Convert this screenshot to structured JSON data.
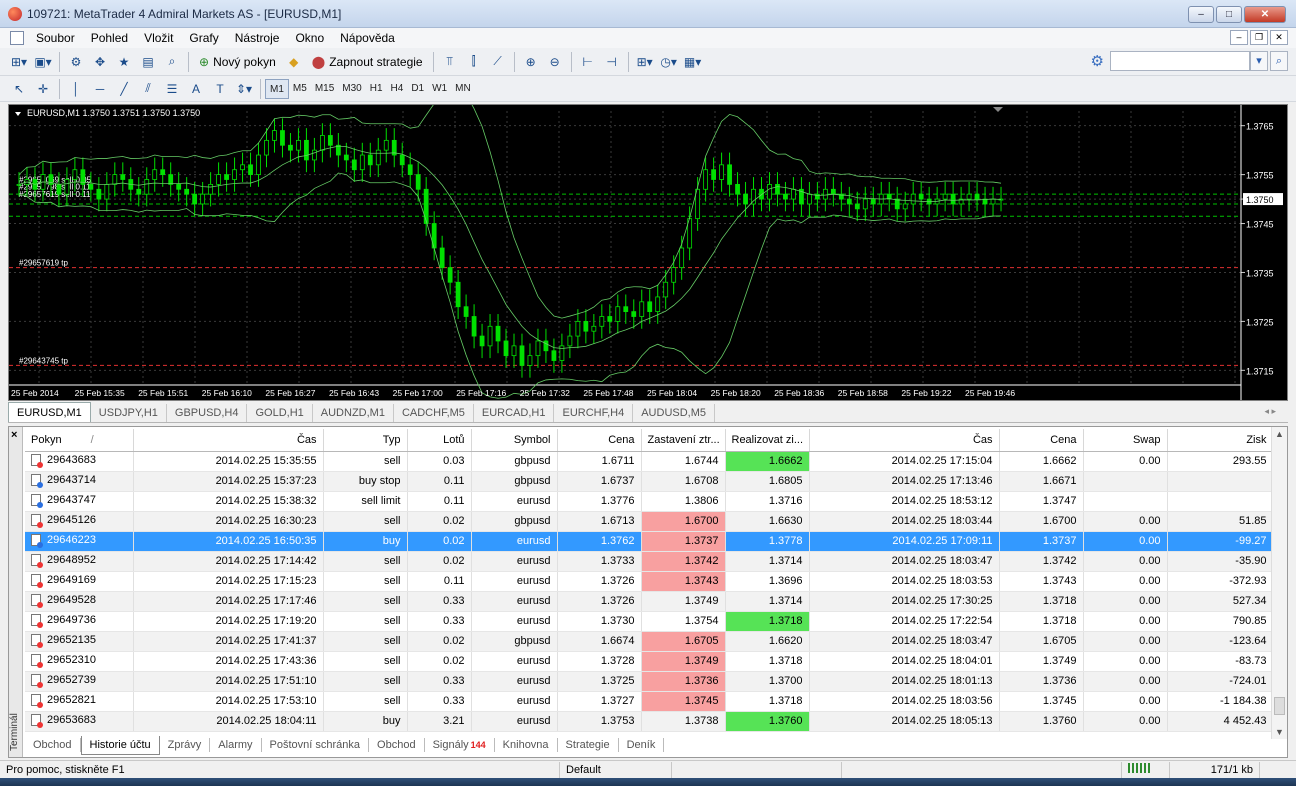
{
  "window": {
    "title": "109721: MetaTrader 4 Admiral Markets AS - [EURUSD,M1]",
    "buttons": [
      "–",
      "□",
      "✕"
    ]
  },
  "menu": [
    "Soubor",
    "Pohled",
    "Vložit",
    "Grafy",
    "Nástroje",
    "Okno",
    "Nápověda"
  ],
  "toolbar": {
    "new_order": "Nový pokyn",
    "auto_trading": "Zapnout strategie"
  },
  "timeframes": [
    "M1",
    "M5",
    "M15",
    "M30",
    "H1",
    "H4",
    "D1",
    "W1",
    "MN"
  ],
  "active_timeframe": "M1",
  "chart": {
    "header": "EURUSD,M1  1.3750 1.3751 1.3750 1.3750",
    "current_price": "1.3750",
    "price_labels": [
      "1.3765",
      "1.3755",
      "1.3750",
      "1.3745",
      "1.3735",
      "1.3725",
      "1.3715"
    ],
    "time_labels": [
      "25 Feb 2014",
      "25 Feb 15:35",
      "25 Feb 15:51",
      "25 Feb 16:10",
      "25 Feb 16:27",
      "25 Feb 16:43",
      "25 Feb 17:00",
      "25 Feb 17:16",
      "25 Feb 17:32",
      "25 Feb 17:48",
      "25 Feb 18:04",
      "25 Feb 18:20",
      "25 Feb 18:36",
      "25 Feb 18:58",
      "25 Feb 19:22",
      "25 Feb 19:46"
    ],
    "order_labels": [
      "#29654069 sell 0.05",
      "#29657798 sell 0.11",
      "#29657619 sell 0.11",
      "#29657619 tp",
      "#29643745 tp"
    ],
    "candles_close": [
      1.3753,
      1.3754,
      1.3752,
      1.3755,
      1.3753,
      1.3751,
      1.3754,
      1.3756,
      1.3753,
      1.3752,
      1.375,
      1.3753,
      1.3755,
      1.3754,
      1.3752,
      1.3751,
      1.3754,
      1.3756,
      1.3755,
      1.3753,
      1.3752,
      1.3751,
      1.3749,
      1.3751,
      1.3753,
      1.3755,
      1.3754,
      1.3756,
      1.3757,
      1.3755,
      1.3759,
      1.3762,
      1.3764,
      1.3761,
      1.376,
      1.3762,
      1.3758,
      1.376,
      1.3763,
      1.3761,
      1.3759,
      1.3758,
      1.3756,
      1.3759,
      1.3757,
      1.376,
      1.3762,
      1.3759,
      1.3757,
      1.3755,
      1.3752,
      1.3745,
      1.374,
      1.3736,
      1.3733,
      1.3728,
      1.3726,
      1.3722,
      1.372,
      1.3724,
      1.3721,
      1.3718,
      1.372,
      1.3716,
      1.3718,
      1.3721,
      1.3719,
      1.3717,
      1.372,
      1.3722,
      1.3725,
      1.3723,
      1.3724,
      1.3726,
      1.3725,
      1.3728,
      1.3727,
      1.3726,
      1.3729,
      1.3727,
      1.373,
      1.3733,
      1.3736,
      1.374,
      1.3746,
      1.3752,
      1.3756,
      1.3754,
      1.3757,
      1.3753,
      1.3751,
      1.3749,
      1.3752,
      1.375,
      1.3753,
      1.3751,
      1.375,
      1.3752,
      1.3749,
      1.3751,
      1.375,
      1.3752,
      1.3751,
      1.375,
      1.3749,
      1.3748,
      1.375,
      1.3749,
      1.3751,
      1.375,
      1.3748,
      1.3749,
      1.3751,
      1.375,
      1.3749,
      1.375,
      1.3751,
      1.3749,
      1.375,
      1.3751,
      1.375,
      1.3749,
      1.375,
      1.375
    ]
  },
  "chart_tabs": [
    "EURUSD,M1",
    "USDJPY,H1",
    "GBPUSD,H4",
    "GOLD,H1",
    "AUDNZD,M1",
    "CADCHF,M5",
    "EURCAD,H1",
    "EURCHF,H4",
    "AUDUSD,M5"
  ],
  "active_chart_tab": "EURUSD,M1",
  "history": {
    "columns": [
      "Pokyn",
      "Čas",
      "Typ",
      "Lotů",
      "Symbol",
      "Cena",
      "Zastavení ztr...",
      "Realizovat zi...",
      "Čas",
      "Cena",
      "Swap",
      "Zisk"
    ],
    "sort_indicator": "/",
    "rows": [
      {
        "id": "29643683",
        "open": "2014.02.25 15:35:55",
        "type": "sell",
        "lots": "0.03",
        "symbol": "gbpusd",
        "price": "1.6711",
        "sl": "1.6744",
        "tp": "1.6662",
        "close": "2014.02.25 17:15:04",
        "cprice": "1.6662",
        "swap": "0.00",
        "profit": "293.55",
        "sl_hl": "",
        "tp_hl": "green",
        "side": "sell"
      },
      {
        "id": "29643714",
        "open": "2014.02.25 15:37:23",
        "type": "buy stop",
        "lots": "0.11",
        "symbol": "gbpusd",
        "price": "1.6737",
        "sl": "1.6708",
        "tp": "1.6805",
        "close": "2014.02.25 17:13:46",
        "cprice": "1.6671",
        "swap": "",
        "profit": "",
        "sl_hl": "",
        "tp_hl": "",
        "side": "buy"
      },
      {
        "id": "29643747",
        "open": "2014.02.25 15:38:32",
        "type": "sell limit",
        "lots": "0.11",
        "symbol": "eurusd",
        "price": "1.3776",
        "sl": "1.3806",
        "tp": "1.3716",
        "close": "2014.02.25 18:53:12",
        "cprice": "1.3747",
        "swap": "",
        "profit": "",
        "sl_hl": "",
        "tp_hl": "",
        "side": "buy"
      },
      {
        "id": "29645126",
        "open": "2014.02.25 16:30:23",
        "type": "sell",
        "lots": "0.02",
        "symbol": "gbpusd",
        "price": "1.6713",
        "sl": "1.6700",
        "tp": "1.6630",
        "close": "2014.02.25 18:03:44",
        "cprice": "1.6700",
        "swap": "0.00",
        "profit": "51.85",
        "sl_hl": "red",
        "tp_hl": "",
        "side": "sell"
      },
      {
        "id": "29646223",
        "open": "2014.02.25 16:50:35",
        "type": "buy",
        "lots": "0.02",
        "symbol": "eurusd",
        "price": "1.3762",
        "sl": "1.3737",
        "tp": "1.3778",
        "close": "2014.02.25 17:09:11",
        "cprice": "1.3737",
        "swap": "0.00",
        "profit": "-99.27",
        "sl_hl": "red",
        "tp_hl": "",
        "side": "buy",
        "selected": true
      },
      {
        "id": "29648952",
        "open": "2014.02.25 17:14:42",
        "type": "sell",
        "lots": "0.02",
        "symbol": "eurusd",
        "price": "1.3733",
        "sl": "1.3742",
        "tp": "1.3714",
        "close": "2014.02.25 18:03:47",
        "cprice": "1.3742",
        "swap": "0.00",
        "profit": "-35.90",
        "sl_hl": "red",
        "tp_hl": "",
        "side": "sell"
      },
      {
        "id": "29649169",
        "open": "2014.02.25 17:15:23",
        "type": "sell",
        "lots": "0.11",
        "symbol": "eurusd",
        "price": "1.3726",
        "sl": "1.3743",
        "tp": "1.3696",
        "close": "2014.02.25 18:03:53",
        "cprice": "1.3743",
        "swap": "0.00",
        "profit": "-372.93",
        "sl_hl": "red",
        "tp_hl": "",
        "side": "sell"
      },
      {
        "id": "29649528",
        "open": "2014.02.25 17:17:46",
        "type": "sell",
        "lots": "0.33",
        "symbol": "eurusd",
        "price": "1.3726",
        "sl": "1.3749",
        "tp": "1.3714",
        "close": "2014.02.25 17:30:25",
        "cprice": "1.3718",
        "swap": "0.00",
        "profit": "527.34",
        "sl_hl": "",
        "tp_hl": "",
        "side": "sell"
      },
      {
        "id": "29649736",
        "open": "2014.02.25 17:19:20",
        "type": "sell",
        "lots": "0.33",
        "symbol": "eurusd",
        "price": "1.3730",
        "sl": "1.3754",
        "tp": "1.3718",
        "close": "2014.02.25 17:22:54",
        "cprice": "1.3718",
        "swap": "0.00",
        "profit": "790.85",
        "sl_hl": "",
        "tp_hl": "green",
        "side": "sell"
      },
      {
        "id": "29652135",
        "open": "2014.02.25 17:41:37",
        "type": "sell",
        "lots": "0.02",
        "symbol": "gbpusd",
        "price": "1.6674",
        "sl": "1.6705",
        "tp": "1.6620",
        "close": "2014.02.25 18:03:47",
        "cprice": "1.6705",
        "swap": "0.00",
        "profit": "-123.64",
        "sl_hl": "red",
        "tp_hl": "",
        "side": "sell"
      },
      {
        "id": "29652310",
        "open": "2014.02.25 17:43:36",
        "type": "sell",
        "lots": "0.02",
        "symbol": "eurusd",
        "price": "1.3728",
        "sl": "1.3749",
        "tp": "1.3718",
        "close": "2014.02.25 18:04:01",
        "cprice": "1.3749",
        "swap": "0.00",
        "profit": "-83.73",
        "sl_hl": "red",
        "tp_hl": "",
        "side": "sell"
      },
      {
        "id": "29652739",
        "open": "2014.02.25 17:51:10",
        "type": "sell",
        "lots": "0.33",
        "symbol": "eurusd",
        "price": "1.3725",
        "sl": "1.3736",
        "tp": "1.3700",
        "close": "2014.02.25 18:01:13",
        "cprice": "1.3736",
        "swap": "0.00",
        "profit": "-724.01",
        "sl_hl": "red",
        "tp_hl": "",
        "side": "sell"
      },
      {
        "id": "29652821",
        "open": "2014.02.25 17:53:10",
        "type": "sell",
        "lots": "0.33",
        "symbol": "eurusd",
        "price": "1.3727",
        "sl": "1.3745",
        "tp": "1.3718",
        "close": "2014.02.25 18:03:56",
        "cprice": "1.3745",
        "swap": "0.00",
        "profit": "-1 184.38",
        "sl_hl": "red",
        "tp_hl": "",
        "side": "sell"
      },
      {
        "id": "29653683",
        "open": "2014.02.25 18:04:11",
        "type": "buy",
        "lots": "3.21",
        "symbol": "eurusd",
        "price": "1.3753",
        "sl": "1.3738",
        "tp": "1.3760",
        "close": "2014.02.25 18:05:13",
        "cprice": "1.3760",
        "swap": "0.00",
        "profit": "4 452.43",
        "sl_hl": "",
        "tp_hl": "green",
        "side": "sell"
      }
    ]
  },
  "terminal_label": "Terminál",
  "terminal_tabs": [
    "Obchod",
    "Historie účtu",
    "Zprávy",
    "Alarmy",
    "Poštovní schránka",
    "Obchod",
    "Signály",
    "Knihovna",
    "Strategie",
    "Deník"
  ],
  "signals_badge": "144",
  "active_terminal_tab": "Historie účtu",
  "status": {
    "help": "Pro pomoc, stiskněte F1",
    "profile": "Default",
    "traffic": "171/1 kb"
  },
  "colors": {
    "chart_bg": "#000000",
    "candle": "#00e000",
    "grid": "#3a3a3a",
    "band": "#66cc66",
    "sl_line": "#e03030",
    "tp_line": "#00c000",
    "selection": "#3399ff"
  }
}
